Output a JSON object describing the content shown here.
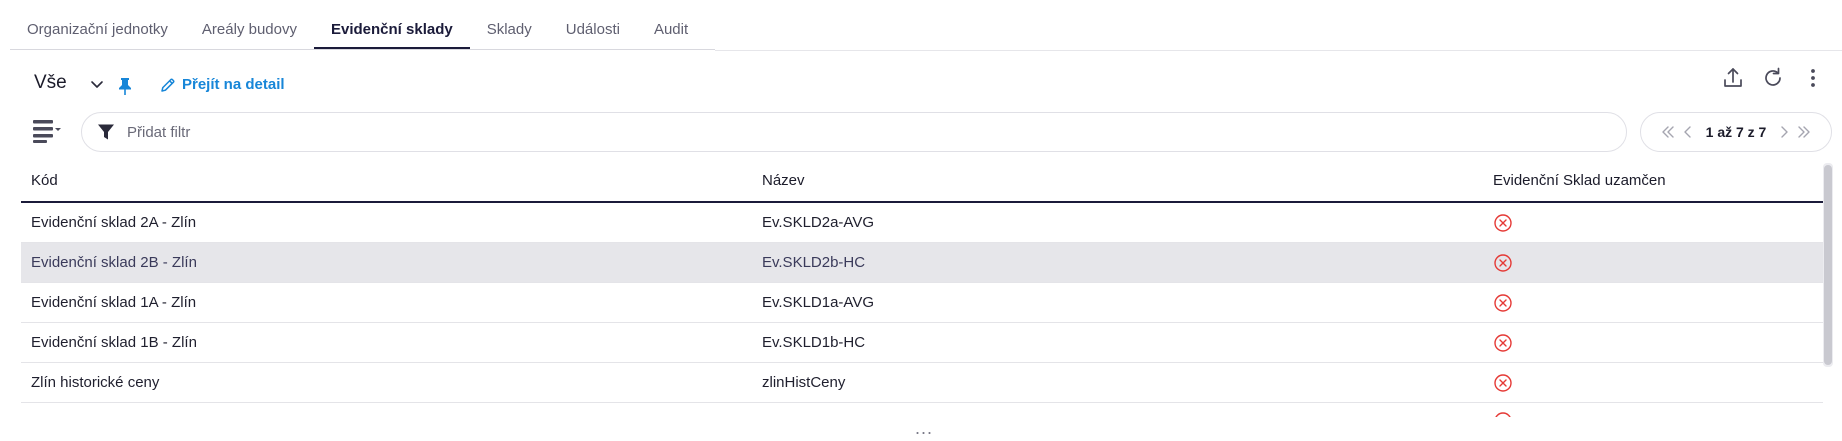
{
  "tabs": [
    {
      "label": "Organizační jednotky",
      "active": false
    },
    {
      "label": "Areály budovy",
      "active": false
    },
    {
      "label": "Evidenční sklady",
      "active": true
    },
    {
      "label": "Sklady",
      "active": false
    },
    {
      "label": "Události",
      "active": false
    },
    {
      "label": "Audit",
      "active": false
    }
  ],
  "toolbar": {
    "view_label": "Vše",
    "detail_label": "Přejít na detail"
  },
  "filter": {
    "placeholder": "Přidat filtr"
  },
  "pager": {
    "text": "1 až 7 z 7"
  },
  "table": {
    "columns": [
      "Kód",
      "Název",
      "Evidenční Sklad uzamčen"
    ],
    "rows": [
      {
        "kod": "Evidenční sklad 2A - Zlín",
        "nazev": "Ev.SKLD2a-AVG",
        "locked": false,
        "selected": false
      },
      {
        "kod": "Evidenční sklad 2B - Zlín",
        "nazev": "Ev.SKLD2b-HC",
        "locked": false,
        "selected": true
      },
      {
        "kod": "Evidenční sklad 1A - Zlín",
        "nazev": "Ev.SKLD1a-AVG",
        "locked": false,
        "selected": false
      },
      {
        "kod": "Evidenční sklad 1B - Zlín",
        "nazev": "Ev.SKLD1b-HC",
        "locked": false,
        "selected": false
      },
      {
        "kod": "Zlín historické ceny",
        "nazev": "zlinHistCeny",
        "locked": false,
        "selected": false
      }
    ]
  },
  "colors": {
    "accent": "#1786d8",
    "active_tab": "#1b1b3a",
    "status_unlocked": "#e53935",
    "selected_row": "#e6e6ea"
  },
  "resize_handle": "..."
}
